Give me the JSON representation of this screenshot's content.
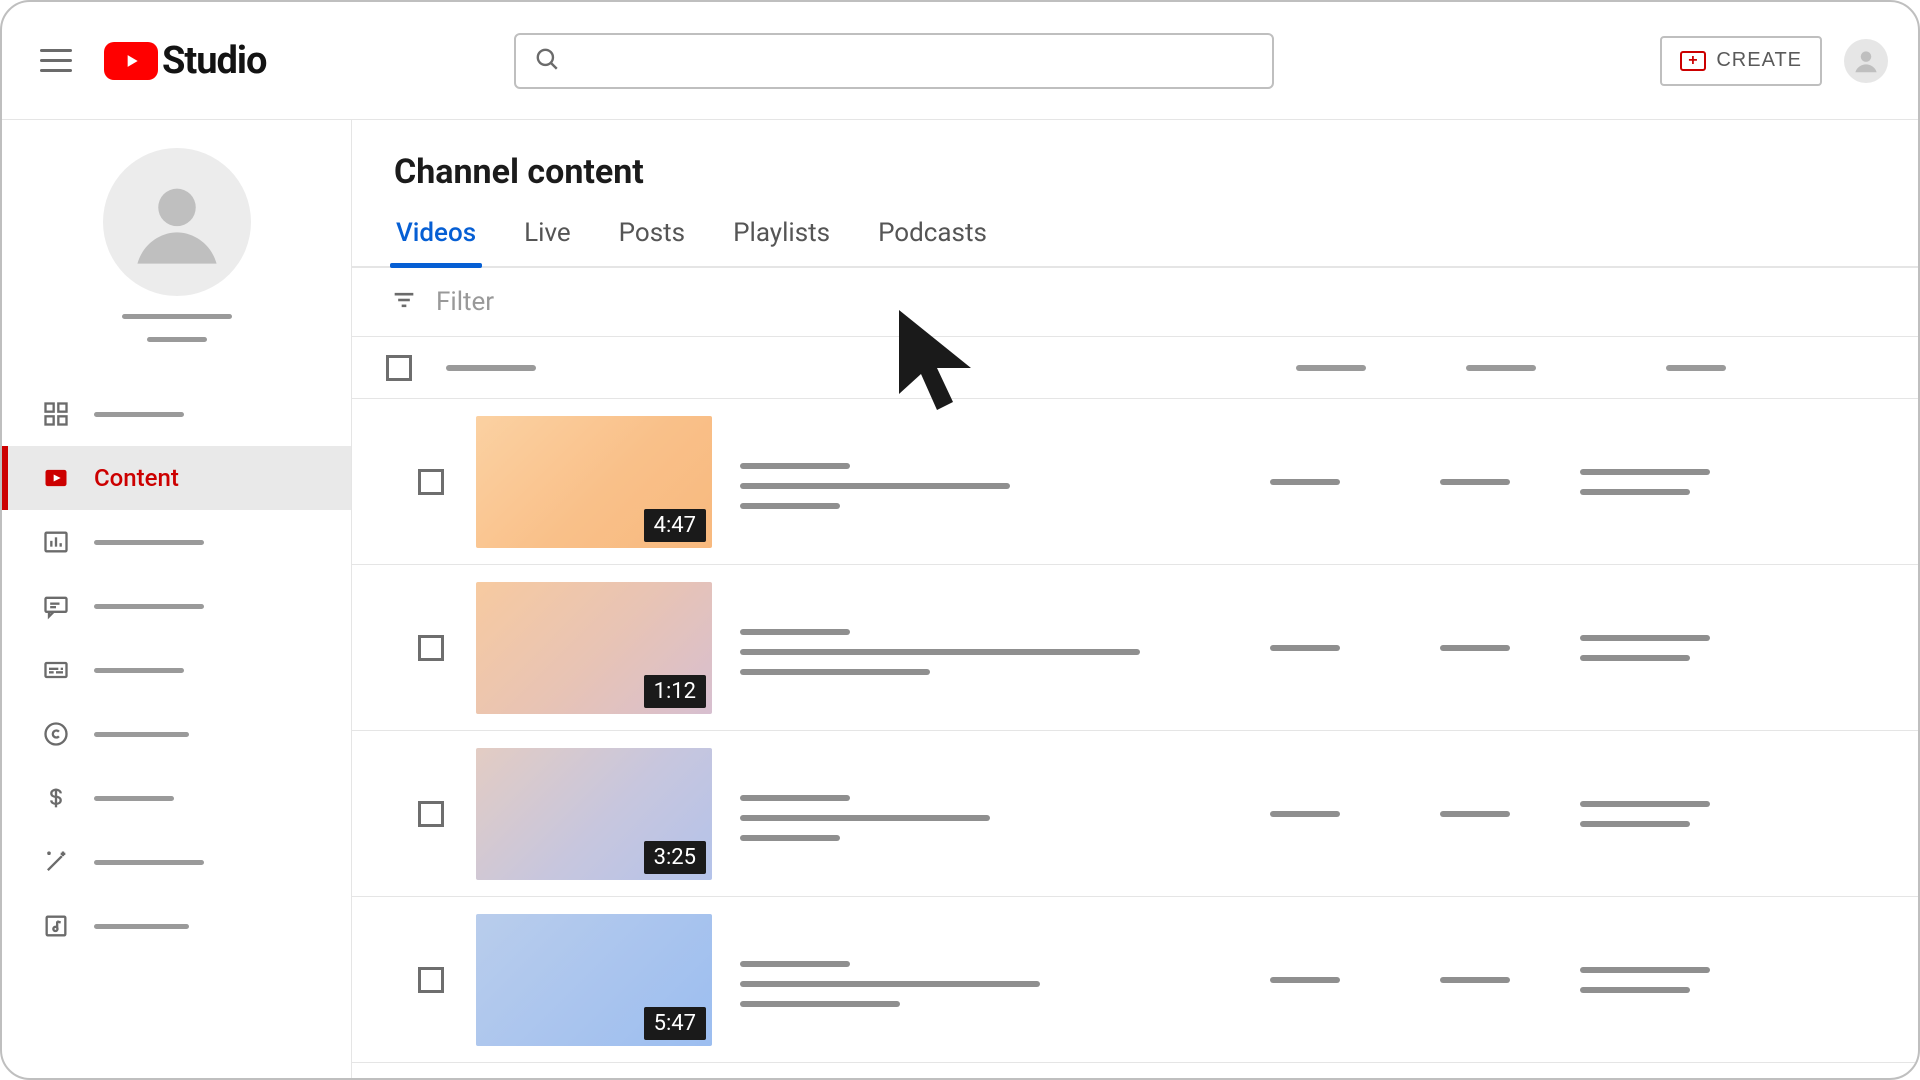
{
  "brand": {
    "name": "Studio"
  },
  "topbar": {
    "search_placeholder": "",
    "create_label": "CREATE"
  },
  "sidebar": {
    "active_label": "Content"
  },
  "page": {
    "title": "Channel content",
    "tabs": [
      "Videos",
      "Live",
      "Posts",
      "Playlists",
      "Podcasts"
    ],
    "active_tab_index": 0,
    "filter_label": "Filter"
  },
  "videos": [
    {
      "duration": "4:47",
      "thumb_class": "grad-a"
    },
    {
      "duration": "1:12",
      "thumb_class": "grad-b"
    },
    {
      "duration": "3:25",
      "thumb_class": "grad-c"
    },
    {
      "duration": "5:47",
      "thumb_class": "grad-d"
    }
  ]
}
